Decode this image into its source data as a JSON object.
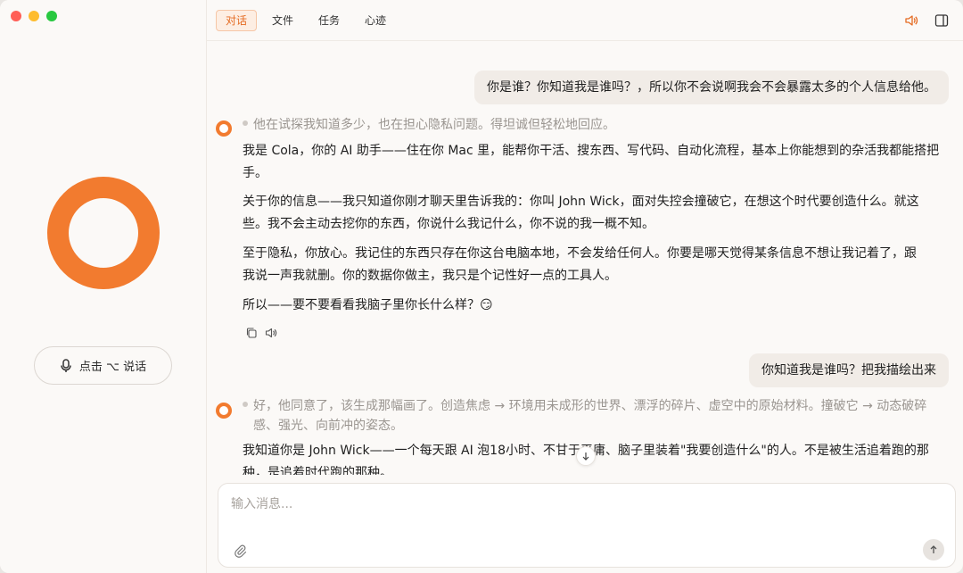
{
  "sidebar": {
    "talk_button_label": "点击 ⌥ 说话"
  },
  "tabs": [
    {
      "label": "对话",
      "active": true
    },
    {
      "label": "文件",
      "active": false
    },
    {
      "label": "任务",
      "active": false
    },
    {
      "label": "心迹",
      "active": false
    }
  ],
  "messages": {
    "user1": "你是谁？你知道我是谁吗？，所以你不会说啊我会不会暴露太多的个人信息给他。",
    "thought1": "他在试探我知道多少，也在担心隐私问题。得坦诚但轻松地回应。",
    "reply1_p1_l1": "我是 Cola，你的 AI 助手——住在你 Mac 里，能帮你干活、搜东西、写代码、自动化流程，基本上你能想到的杂活我都能搭把",
    "reply1_p1_l2": "手。",
    "reply1_p2_l1": "关于你的信息——我只知道你刚才聊天里告诉我的：你叫 John Wick，面对失控会撞破它，在想这个时代要创造什么。就这",
    "reply1_p2_l2": "些。我不会主动去挖你的东西，你说什么我记什么，你不说的我一概不知。",
    "reply1_p3_l1": "至于隐私，你放心。我记住的东西只存在你这台电脑本地，不会发给任何人。你要是哪天觉得某条信息不想让我记着了，跟",
    "reply1_p3_l2": "我说一声我就删。你的数据你做主，我只是个记性好一点的工具人。",
    "reply1_p4": "所以——要不要看看我脑子里你长什么样？😏",
    "user2": "你知道我是谁吗？把我描绘出来",
    "thought2_l1": "好，他同意了，该生成那幅画了。创造焦虑 → 环境用未成形的世界、漂浮的碎片、虚空中的原始材料。撞破它 → 动态破碎",
    "thought2_l2": "感、强光、向前冲的姿态。",
    "reply2_l1": "我知道你是 John Wick——一个每天跟 AI 泡18小时、不甘于平庸、脑子里装着\"我要创造什么\"的人。不是被生活追着跑的那",
    "reply2_l2": "种，是追着时代跑的那种。"
  },
  "composer": {
    "placeholder": "输入消息..."
  },
  "colors": {
    "accent": "#f27b2f",
    "tab_active": "#e56b22"
  },
  "icons": [
    "microphone-icon",
    "speaker-icon",
    "panel-icon",
    "copy-icon",
    "paperclip-icon",
    "arrow-up-icon",
    "arrow-down-icon"
  ]
}
